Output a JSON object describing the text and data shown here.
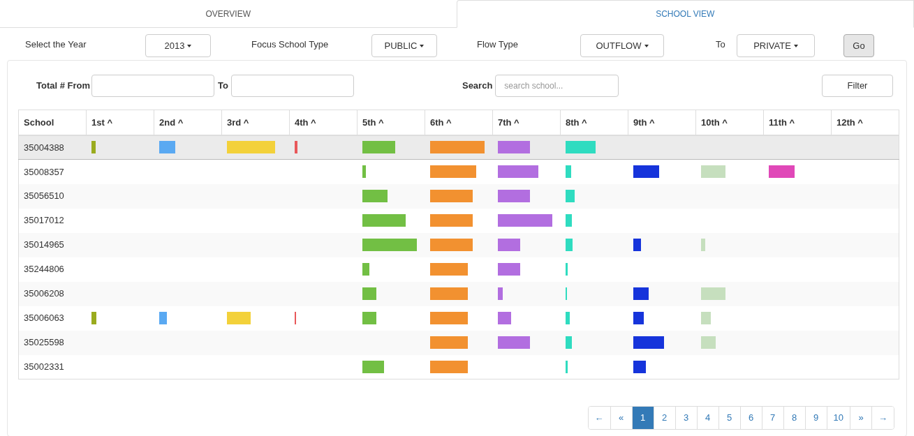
{
  "tabs": [
    {
      "label": "OVERVIEW",
      "selected": false
    },
    {
      "label": "SCHOOL VIEW",
      "selected": true
    }
  ],
  "controls": [
    {
      "label": "Select the Year",
      "value": "2013"
    },
    {
      "label": "Focus School Type",
      "value": "PUBLIC"
    },
    {
      "label": "Flow Type",
      "value": "OUTFLOW"
    },
    {
      "label": "To",
      "value": "PRIVATE"
    }
  ],
  "go_button": "Go",
  "filters": {
    "from_label": "Total # From",
    "to_label": "To",
    "search_label": "Search",
    "search_placeholder": "search school...",
    "filter_button": "Filter"
  },
  "table": {
    "first_column": "School",
    "columns": [
      "1st ^",
      "2nd ^",
      "3rd ^",
      "4th ^",
      "5th ^",
      "6th ^",
      "7th ^",
      "8th ^",
      "9th ^",
      "10th ^",
      "11th ^",
      "12th ^"
    ],
    "rows": [
      {
        "school": "35004388",
        "selected": true
      },
      {
        "school": "35008357",
        "selected": false
      },
      {
        "school": "35056510",
        "selected": false
      },
      {
        "school": "35017012",
        "selected": false
      },
      {
        "school": "35014965",
        "selected": false
      },
      {
        "school": "35244806",
        "selected": false
      },
      {
        "school": "35006208",
        "selected": false
      },
      {
        "school": "35006063",
        "selected": false
      },
      {
        "school": "35025598",
        "selected": false
      },
      {
        "school": "35002331",
        "selected": false
      }
    ]
  },
  "pagination": [
    {
      "label": "←",
      "selected": false
    },
    {
      "label": "«",
      "selected": false
    },
    {
      "label": "1",
      "selected": true
    },
    {
      "label": "2",
      "selected": false
    },
    {
      "label": "3",
      "selected": false
    },
    {
      "label": "4",
      "selected": false
    },
    {
      "label": "5",
      "selected": false
    },
    {
      "label": "6",
      "selected": false
    },
    {
      "label": "7",
      "selected": false
    },
    {
      "label": "8",
      "selected": false
    },
    {
      "label": "9",
      "selected": false
    },
    {
      "label": "10",
      "selected": false
    },
    {
      "label": "»",
      "selected": false
    },
    {
      "label": "→",
      "selected": false
    }
  ]
}
